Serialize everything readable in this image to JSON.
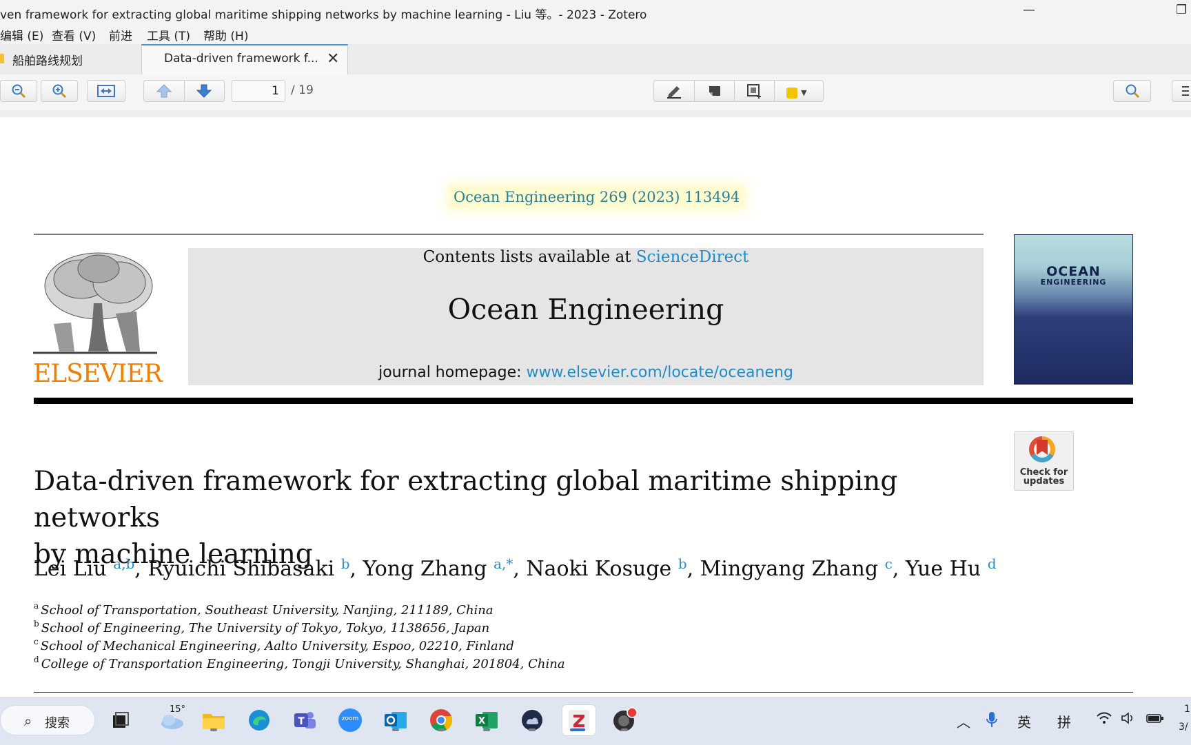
{
  "window": {
    "title": "ven framework for extracting global maritime shipping networks by machine learning - Liu 等。- 2023 - Zotero"
  },
  "menu": {
    "items": [
      "编辑 (E)",
      "查看 (V)",
      "前进",
      "工具 (T)",
      "帮助 (H)"
    ]
  },
  "tabs": {
    "library_label": "船舶路线规划",
    "reader_label": "Data-driven framework f...",
    "close_glyph": "✕"
  },
  "toolbar": {
    "page_current": "1",
    "page_total": "/ 19",
    "highlight_color": "#f5c400"
  },
  "paper": {
    "citation": "Ocean Engineering 269 (2023) 113494",
    "publisher_wordmark": "ELSEVIER",
    "contents_prefix": "Contents lists available at ",
    "contents_link": "ScienceDirect",
    "journal_name": "Ocean Engineering",
    "homepage_prefix": "journal homepage: ",
    "homepage_link": "www.elsevier.com/locate/oceaneng",
    "cover_title_1": "OCEAN",
    "cover_title_2": "ENGINEERING",
    "check_badge_line1": "Check for",
    "check_badge_line2": "updates",
    "title_line1": "Data-driven framework for extracting global maritime shipping networks",
    "title_line2": "by machine learning",
    "authors": [
      {
        "name": "Lei Liu",
        "sup": "a,b",
        "sep": ", "
      },
      {
        "name": "Ryuichi Shibasaki",
        "sup": "b",
        "sep": ", "
      },
      {
        "name": "Yong Zhang",
        "sup": "a,*",
        "sep": ", "
      },
      {
        "name": "Naoki Kosuge",
        "sup": "b",
        "sep": ", "
      },
      {
        "name": "Mingyang Zhang",
        "sup": "c",
        "sep": ", "
      },
      {
        "name": "Yue Hu",
        "sup": "d",
        "sep": ""
      }
    ],
    "affiliations": [
      {
        "mark": "a",
        "text": "School of Transportation, Southeast University, Nanjing, 211189, China"
      },
      {
        "mark": "b",
        "text": "School of Engineering, The University of Tokyo, Tokyo, 1138656, Japan"
      },
      {
        "mark": "c",
        "text": "School of Mechanical Engineering, Aalto University, Espoo, 02210, Finland"
      },
      {
        "mark": "d",
        "text": "College of Transportation Engineering, Tongji University, Shanghai, 201804, China"
      }
    ]
  },
  "taskbar": {
    "search_label": "搜索",
    "weather_temp": "15°",
    "apps": [
      "task-view",
      "weather",
      "file-explorer",
      "edge",
      "teams",
      "zoom",
      "outlook",
      "chrome",
      "excel",
      "cloud-app",
      "zotero",
      "obs"
    ],
    "zoom_label": "zoom",
    "ime_lang": "英",
    "ime_mode": "拼",
    "clock_fragment_1": "1",
    "clock_fragment_2": "3/"
  },
  "colors": {
    "link": "#1f8bc8",
    "elsevier_orange": "#f07e00",
    "citation": "#2a7f92",
    "tab_accent": "#4a90d9"
  }
}
